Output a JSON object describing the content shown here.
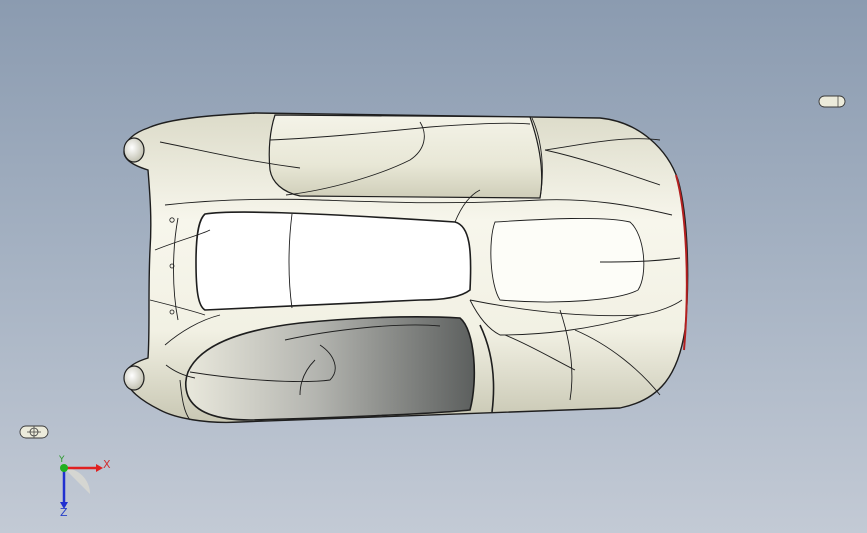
{
  "viewport": {
    "background_top": "#8b9bb0",
    "background_bottom": "#c3cad5",
    "model": {
      "body_color": "#f3f2e6",
      "shade_color": "#c9c8b6",
      "dark_panel_color": "#7d7f7c",
      "edge_color": "#1e1e1e",
      "accent_edge_color": "#b32020"
    },
    "triad": {
      "x_label": "X",
      "y_label": "Y",
      "z_label": "Z",
      "x_color": "#e02020",
      "y_color": "#20b020",
      "z_color": "#2030d0"
    },
    "icons": [
      "light-source-icon",
      "camera-icon",
      "orientation-triad-icon"
    ]
  }
}
